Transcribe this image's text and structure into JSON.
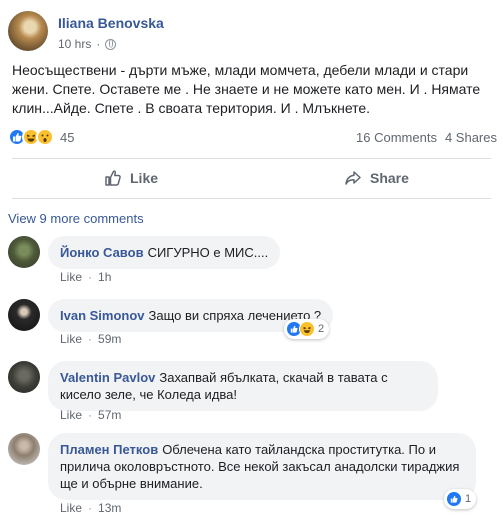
{
  "post": {
    "author": "Iliana Benovska",
    "time": "10 hrs",
    "dot": "·",
    "text": "Неосъществени - дърти мъже, млади момчета, дебели млади и стари жени. Спете. Оставете ме . Не знаете и не можете като мен. И . Нямате клин...Айде. Спете . В своата територия. И . Млъкнете.",
    "reaction_count": "45",
    "comments_count": "16 Comments",
    "shares_count": "4 Shares"
  },
  "actions": {
    "like_label": "Like",
    "share_label": "Share"
  },
  "view_more": "View 9 more comments",
  "comments": [
    {
      "name": "Йонко Савов",
      "text": "СИГУРНО е МИС....",
      "like": "Like",
      "time": "1h"
    },
    {
      "name": "Ivan Simonov",
      "text": "Защо ви спряха лечението ?",
      "like": "Like",
      "time": "59m",
      "reactions": "2"
    },
    {
      "name": "Valentin Pavlov",
      "text": "Захапвай ябълката, скачай в тавата с кисело зеле, че Коледа идва!",
      "like": "Like",
      "time": "57m"
    },
    {
      "name": "Пламен Петков",
      "text": "Облечена като тайландска проститутка. По и прилича околовръстното. Все некой закъсал анадолски тираджия ще и обърне внимание.",
      "like": "Like",
      "time": "13m",
      "reactions": "1"
    }
  ],
  "sep": "·",
  "colors": {
    "link": "#385898",
    "like_blue": "#2078f4",
    "bubble": "#f2f3f5",
    "meta": "#606770"
  }
}
